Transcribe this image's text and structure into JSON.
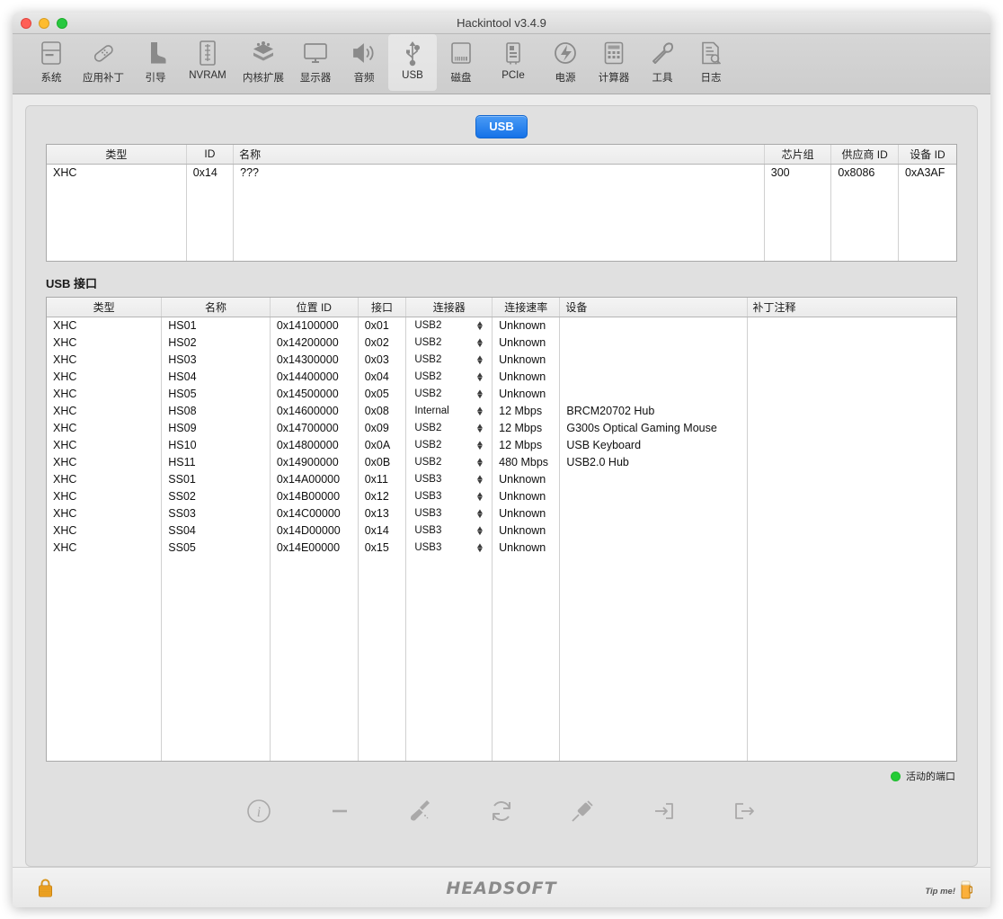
{
  "window": {
    "title": "Hackintool v3.4.9",
    "traffic_lights": [
      "close-button",
      "minimize-button",
      "zoom-button"
    ]
  },
  "toolbar": {
    "items": [
      {
        "label": "系统",
        "icon": "system-icon",
        "selected": false
      },
      {
        "label": "应用补丁",
        "icon": "patch-icon",
        "selected": false
      },
      {
        "label": "引导",
        "icon": "boot-icon",
        "selected": false
      },
      {
        "label": "NVRAM",
        "icon": "nvram-icon",
        "selected": false
      },
      {
        "label": "内核扩展",
        "icon": "kext-icon",
        "selected": false
      },
      {
        "label": "显示器",
        "icon": "display-icon",
        "selected": false
      },
      {
        "label": "音频",
        "icon": "audio-icon",
        "selected": false
      },
      {
        "label": "USB",
        "icon": "usb-icon",
        "selected": true
      },
      {
        "label": "磁盘",
        "icon": "disk-icon",
        "selected": false
      },
      {
        "label": "PCIe",
        "icon": "pcie-icon",
        "selected": false
      },
      {
        "label": "电源",
        "icon": "power-icon",
        "selected": false
      },
      {
        "label": "计算器",
        "icon": "calculator-icon",
        "selected": false
      },
      {
        "label": "工具",
        "icon": "tools-icon",
        "selected": false
      },
      {
        "label": "日志",
        "icon": "log-icon",
        "selected": false
      }
    ]
  },
  "tab_pill": {
    "label": "USB"
  },
  "controller_table": {
    "columns": [
      "类型",
      "ID",
      "名称",
      "芯片组",
      "供应商 ID",
      "设备 ID"
    ],
    "rows": [
      {
        "type": "XHC",
        "id": "0x14",
        "name": "???",
        "chipset": "300",
        "vendor_id": "0x8086",
        "device_id": "0xA3AF"
      }
    ]
  },
  "usb_section": {
    "title": "USB 接口",
    "columns": [
      "类型",
      "名称",
      "位置 ID",
      "接口",
      "连接器",
      "连接速率",
      "设备",
      "补丁注释"
    ],
    "rows": [
      {
        "type": "XHC",
        "name": "HS01",
        "location_id": "0x14100000",
        "port": "0x01",
        "connector": "USB2",
        "speed": "Unknown",
        "device": "",
        "comment": "",
        "active": true
      },
      {
        "type": "XHC",
        "name": "HS02",
        "location_id": "0x14200000",
        "port": "0x02",
        "connector": "USB2",
        "speed": "Unknown",
        "device": "",
        "comment": "",
        "active": true
      },
      {
        "type": "XHC",
        "name": "HS03",
        "location_id": "0x14300000",
        "port": "0x03",
        "connector": "USB2",
        "speed": "Unknown",
        "device": "",
        "comment": "",
        "active": true
      },
      {
        "type": "XHC",
        "name": "HS04",
        "location_id": "0x14400000",
        "port": "0x04",
        "connector": "USB2",
        "speed": "Unknown",
        "device": "",
        "comment": "",
        "active": true
      },
      {
        "type": "XHC",
        "name": "HS05",
        "location_id": "0x14500000",
        "port": "0x05",
        "connector": "USB2",
        "speed": "Unknown",
        "device": "",
        "comment": "",
        "active": true
      },
      {
        "type": "XHC",
        "name": "HS08",
        "location_id": "0x14600000",
        "port": "0x08",
        "connector": "Internal",
        "speed": "12 Mbps",
        "device": "BRCM20702 Hub",
        "comment": "",
        "active": true
      },
      {
        "type": "XHC",
        "name": "HS09",
        "location_id": "0x14700000",
        "port": "0x09",
        "connector": "USB2",
        "speed": "12 Mbps",
        "device": "G300s Optical Gaming Mouse",
        "comment": "",
        "active": true
      },
      {
        "type": "XHC",
        "name": "HS10",
        "location_id": "0x14800000",
        "port": "0x0A",
        "connector": "USB2",
        "speed": "12 Mbps",
        "device": "USB Keyboard",
        "comment": "",
        "active": true
      },
      {
        "type": "XHC",
        "name": "HS11",
        "location_id": "0x14900000",
        "port": "0x0B",
        "connector": "USB2",
        "speed": "480 Mbps",
        "device": "USB2.0 Hub",
        "comment": "",
        "active": true
      },
      {
        "type": "XHC",
        "name": "SS01",
        "location_id": "0x14A00000",
        "port": "0x11",
        "connector": "USB3",
        "speed": "Unknown",
        "device": "",
        "comment": "",
        "active": true
      },
      {
        "type": "XHC",
        "name": "SS02",
        "location_id": "0x14B00000",
        "port": "0x12",
        "connector": "USB3",
        "speed": "Unknown",
        "device": "",
        "comment": "",
        "active": true
      },
      {
        "type": "XHC",
        "name": "SS03",
        "location_id": "0x14C00000",
        "port": "0x13",
        "connector": "USB3",
        "speed": "Unknown",
        "device": "",
        "comment": "",
        "active": true
      },
      {
        "type": "XHC",
        "name": "SS04",
        "location_id": "0x14D00000",
        "port": "0x14",
        "connector": "USB3",
        "speed": "Unknown",
        "device": "",
        "comment": "",
        "active": true
      },
      {
        "type": "XHC",
        "name": "SS05",
        "location_id": "0x14E00000",
        "port": "0x15",
        "connector": "USB3",
        "speed": "Unknown",
        "device": "",
        "comment": "",
        "active": true
      }
    ]
  },
  "legend": {
    "label": "活动的端口",
    "color": "#24cc36"
  },
  "action_buttons": [
    {
      "icon": "info-icon",
      "name": "info-button"
    },
    {
      "icon": "minus-icon",
      "name": "remove-button"
    },
    {
      "icon": "broom-icon",
      "name": "clear-button"
    },
    {
      "icon": "refresh-icon",
      "name": "refresh-button"
    },
    {
      "icon": "syringe-icon",
      "name": "inject-button"
    },
    {
      "icon": "import-icon",
      "name": "import-button"
    },
    {
      "icon": "export-icon",
      "name": "export-button"
    }
  ],
  "footer": {
    "brand": "HEADSOFT",
    "tip_label": "Tip me!",
    "lock_icon": "lock-icon",
    "beer_icon": "beer-icon"
  }
}
